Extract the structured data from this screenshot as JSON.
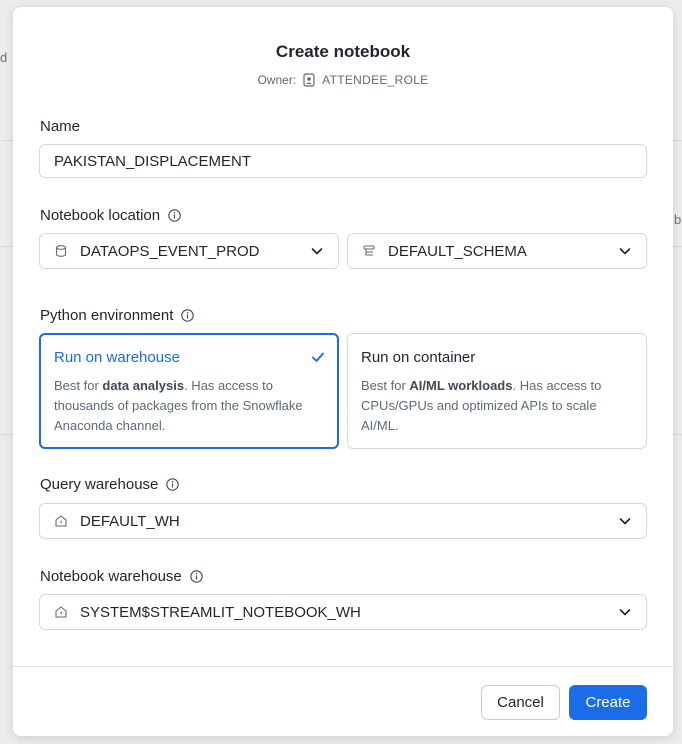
{
  "background": {
    "left_fragment": "d",
    "right_fragment": "bl"
  },
  "modal": {
    "title": "Create notebook",
    "owner_label": "Owner:",
    "owner_name": "ATTENDEE_ROLE",
    "name": {
      "label": "Name",
      "value": "PAKISTAN_DISPLACEMENT"
    },
    "location": {
      "label": "Notebook location",
      "database": "DATAOPS_EVENT_PROD",
      "schema": "DEFAULT_SCHEMA"
    },
    "python_env": {
      "label": "Python environment",
      "options": [
        {
          "title": "Run on warehouse",
          "desc_pre": "Best for ",
          "desc_bold": "data analysis",
          "desc_post": ". Has access to thousands of packages from the Snowflake Anaconda channel.",
          "selected": true
        },
        {
          "title": "Run on container",
          "desc_pre": "Best for ",
          "desc_bold": "AI/ML workloads",
          "desc_post": ". Has access to CPUs/GPUs and optimized APIs to scale AI/ML.",
          "selected": false
        }
      ]
    },
    "query_warehouse": {
      "label": "Query warehouse",
      "value": "DEFAULT_WH"
    },
    "notebook_warehouse": {
      "label": "Notebook warehouse",
      "value": "SYSTEM$STREAMLIT_NOTEBOOK_WH"
    },
    "buttons": {
      "cancel": "Cancel",
      "create": "Create"
    }
  },
  "colors": {
    "accent": "#1a6ce7",
    "text": "#1e252f",
    "muted": "#5d6a78",
    "border": "#d5d9de"
  }
}
